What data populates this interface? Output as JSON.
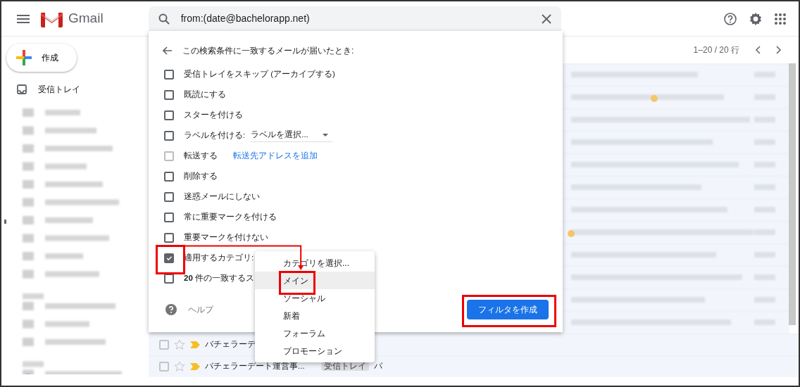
{
  "header": {
    "app_name": "Gmail",
    "search": {
      "value": "from:(date@bachelorapp.net)"
    }
  },
  "compose": {
    "label": "作成"
  },
  "sidebar": {
    "items": [
      {
        "label": "受信トレイ"
      }
    ]
  },
  "pagination": "1–20 / 20 行",
  "filter_panel": {
    "title": "この検索条件に一致するメールが届いたとき:",
    "options": [
      {
        "kind": "check",
        "label": "受信トレイをスキップ (アーカイブする)",
        "checked": false,
        "disabled": false,
        "highlighted": false
      },
      {
        "kind": "check",
        "label": "既読にする",
        "checked": false,
        "disabled": false,
        "highlighted": false
      },
      {
        "kind": "check",
        "label": "スターを付ける",
        "checked": false,
        "disabled": false,
        "highlighted": false
      },
      {
        "kind": "label",
        "label": "ラベルを付ける:",
        "select": "ラベルを選択...",
        "checked": false,
        "disabled": false,
        "highlighted": false
      },
      {
        "kind": "forward",
        "label": "転送する",
        "link": "転送先アドレスを追加",
        "checked": false,
        "disabled": true,
        "highlighted": false
      },
      {
        "kind": "check",
        "label": "削除する",
        "checked": false,
        "disabled": false,
        "highlighted": false
      },
      {
        "kind": "check",
        "label": "迷惑メールにしない",
        "checked": false,
        "disabled": false,
        "highlighted": false
      },
      {
        "kind": "check",
        "label": "常に重要マークを付ける",
        "checked": false,
        "disabled": false,
        "highlighted": false
      },
      {
        "kind": "check",
        "label": "重要マークを付けない",
        "checked": false,
        "disabled": false,
        "highlighted": false
      },
      {
        "kind": "category",
        "label": "適用するカテゴリ:",
        "checked": true,
        "disabled": false,
        "highlighted": true
      },
      {
        "kind": "check",
        "label": "**20** 件の一致するス",
        "checked": false,
        "disabled": false,
        "highlighted": false
      }
    ],
    "help": "ヘルプ",
    "create_button": {
      "label": "フィルタを作成",
      "highlighted": true
    }
  },
  "category_menu": {
    "annotation_arrow": true,
    "items": [
      {
        "label": "カテゴリを選択...",
        "selected": false,
        "highlighted": false
      },
      {
        "label": "メイン",
        "selected": true,
        "highlighted": true
      },
      {
        "label": "ソーシャル",
        "selected": false,
        "highlighted": false
      },
      {
        "label": "新着",
        "selected": false,
        "highlighted": false
      },
      {
        "label": "フォーラム",
        "selected": false,
        "highlighted": false
      },
      {
        "label": "プロモーション",
        "selected": false,
        "highlighted": false
      }
    ]
  },
  "mail_rows": [
    {
      "sender": "バチェラーデ",
      "checked": false,
      "starred": false
    },
    {
      "sender": "バチェラーデート運営事...",
      "tag": "受信トレイ",
      "snippet": "パ",
      "checked": false,
      "starred": false
    }
  ]
}
